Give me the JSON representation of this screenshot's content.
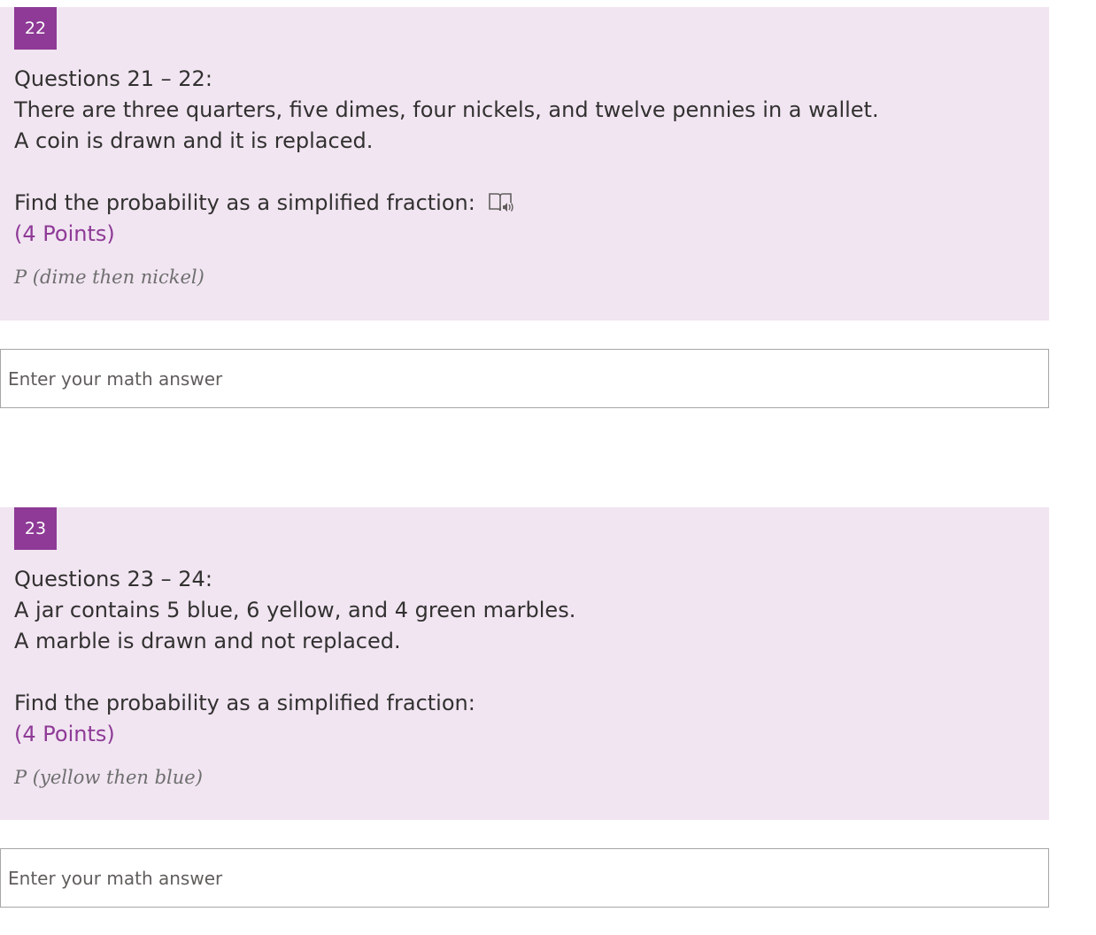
{
  "questions": [
    {
      "number": "22",
      "lines": [
        "Questions 21 – 22:",
        "There are three quarters, five dimes, four nickels, and twelve pennies in a wallet.",
        "A coin is drawn and it is replaced."
      ],
      "prompt": "Find the probability as a simplified fraction:",
      "points": "(4 Points)",
      "subtitle": "P (dime then nickel)",
      "answer_placeholder": "Enter your math answer",
      "has_reader_icon": true
    },
    {
      "number": "23",
      "lines": [
        "Questions 23 – 24:",
        "A jar contains 5 blue, 6 yellow, and 4 green marbles.",
        "A marble is drawn and not replaced."
      ],
      "prompt": "Find the probability as a simplified fraction:",
      "points": "(4 Points)",
      "subtitle": "P (yellow then blue)",
      "answer_placeholder": "Enter your math answer",
      "has_reader_icon": false
    }
  ],
  "icons": {
    "reader": "immersive-reader-icon"
  },
  "colors": {
    "accent": "#8e3a96",
    "card_background": "#f1e5f2",
    "text": "#323130",
    "subtitle": "#6e6e6e",
    "input_border": "#a6a6a6"
  }
}
